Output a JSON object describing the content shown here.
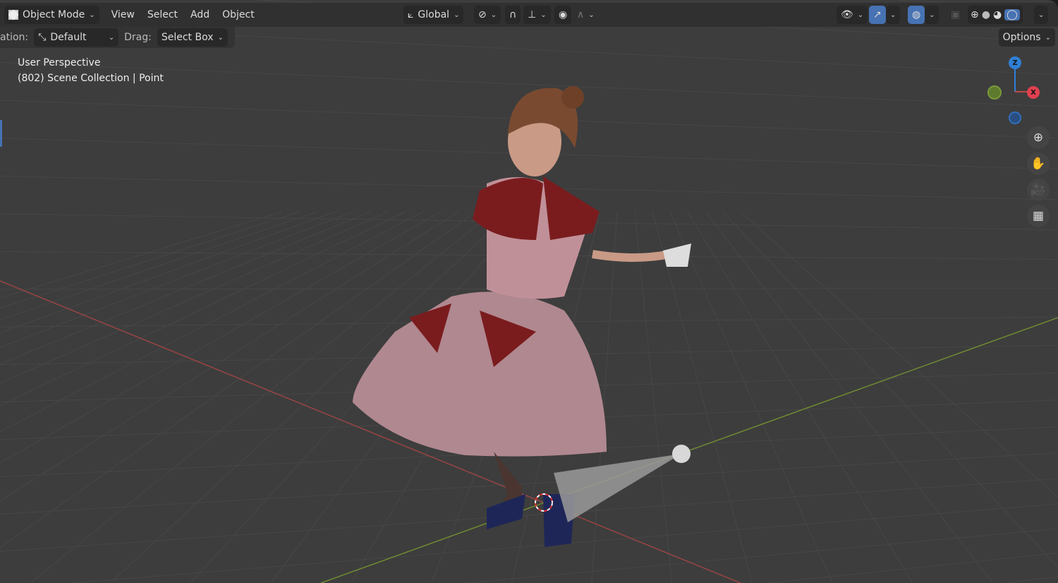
{
  "header": {
    "mode": "Object Mode",
    "menus": [
      "View",
      "Select",
      "Add",
      "Object"
    ],
    "orientation": "Global"
  },
  "toolbar": {
    "orientation_label": "ation:",
    "orientation_value": "Default",
    "drag_label": "Drag:",
    "drag_value": "Select Box",
    "options": "Options"
  },
  "overlay": {
    "view_name": "User Perspective",
    "collection": "(802) Scene Collection | Point"
  },
  "gizmo": {
    "z": "Z",
    "x": "X"
  },
  "colors": {
    "accent": "#4772b3",
    "x_axis": "#c04848",
    "y_axis": "#7a9a3a",
    "z_axis": "#2f7fd6"
  }
}
